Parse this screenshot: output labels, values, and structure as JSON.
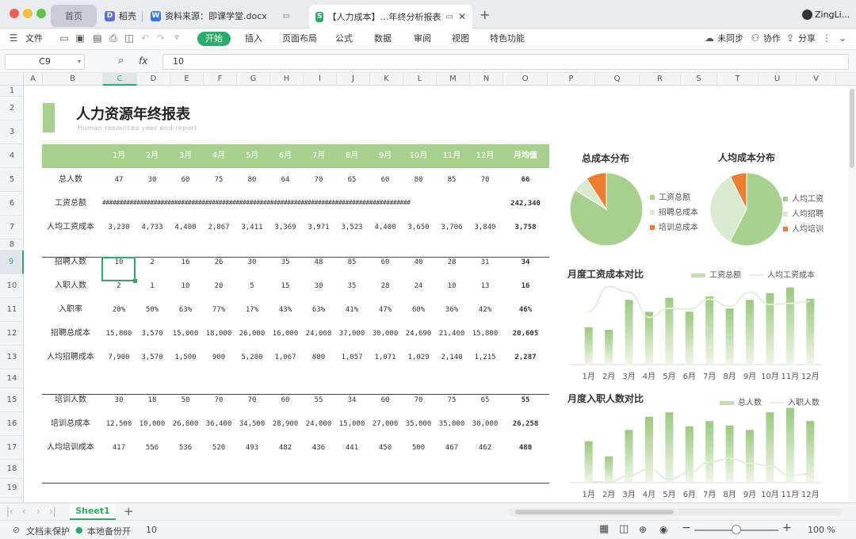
{
  "tabs": [
    {
      "label": "首页"
    },
    {
      "label": "稻壳"
    },
    {
      "label": "资料来源：即课学堂.docx"
    },
    {
      "label": "【人力成本】…年终分析报表"
    }
  ],
  "user": {
    "name": "ZingLi..."
  },
  "menu": {
    "file": "文件",
    "start": "开始",
    "items": [
      "插入",
      "页面布局",
      "公式",
      "数据",
      "审阅",
      "视图",
      "特色功能"
    ],
    "sync": "未同步",
    "collab": "协作",
    "share": "分享"
  },
  "formula": {
    "cell_ref": "C9",
    "fx": "fx",
    "value": "10"
  },
  "columns": [
    "A",
    "B",
    "C",
    "D",
    "E",
    "F",
    "G",
    "H",
    "I",
    "J",
    "K",
    "L",
    "M",
    "N",
    "O",
    "P",
    "Q",
    "R",
    "S",
    "T",
    "U",
    "V"
  ],
  "rows": [
    "1",
    "2",
    "3",
    "4",
    "5",
    "6",
    "7",
    "8",
    "9",
    "10",
    "11",
    "12",
    "13",
    "14",
    "15",
    "16",
    "17",
    "18",
    "19"
  ],
  "report": {
    "title": "人力资源年终报表",
    "subtitle": "Human resources year end report",
    "header": [
      "1月",
      "2月",
      "3月",
      "4月",
      "5月",
      "6月",
      "7月",
      "8月",
      "9月",
      "10月",
      "11月",
      "12月",
      "月均值"
    ],
    "hash_text": "##########################################################################################",
    "table_rows": [
      {
        "label": "总人数",
        "values": [
          "47",
          "30",
          "60",
          "75",
          "80",
          "64",
          "70",
          "65",
          "60",
          "80",
          "85",
          "70"
        ],
        "avg": "66"
      },
      {
        "label": "工资总额",
        "values": [],
        "avg": "242,340"
      },
      {
        "label": "人均工资成本",
        "values": [
          "3,230",
          "4,733",
          "4,400",
          "2,867",
          "3,411",
          "3,369",
          "3,971",
          "3,523",
          "4,400",
          "3,650",
          "3,706",
          "3,840"
        ],
        "avg": "3,758"
      },
      {
        "label": "招聘人数",
        "values": [
          "10",
          "2",
          "16",
          "26",
          "30",
          "35",
          "48",
          "85",
          "60",
          "40",
          "28",
          "31"
        ],
        "avg": "34"
      },
      {
        "label": "入职人数",
        "values": [
          "2",
          "1",
          "10",
          "20",
          "5",
          "15",
          "30",
          "35",
          "28",
          "24",
          "10",
          "13"
        ],
        "avg": "16"
      },
      {
        "label": "入职率",
        "values": [
          "20%",
          "50%",
          "63%",
          "77%",
          "17%",
          "43%",
          "63%",
          "41%",
          "47%",
          "60%",
          "36%",
          "42%"
        ],
        "avg": "46%"
      },
      {
        "label": "招聘总成本",
        "values": [
          "15,800",
          "3,570",
          "15,000",
          "18,000",
          "26,000",
          "16,000",
          "24,000",
          "37,000",
          "30,000",
          "24,690",
          "21,400",
          "15,800"
        ],
        "avg": "20,605"
      },
      {
        "label": "人均招聘成本",
        "values": [
          "7,900",
          "3,570",
          "1,500",
          "900",
          "5,200",
          "1,067",
          "800",
          "1,057",
          "1,071",
          "1,029",
          "2,140",
          "1,215"
        ],
        "avg": "2,287"
      },
      {
        "label": "培训人数",
        "values": [
          "30",
          "18",
          "50",
          "70",
          "70",
          "60",
          "55",
          "34",
          "60",
          "70",
          "75",
          "65"
        ],
        "avg": "55"
      },
      {
        "label": "培训总成本",
        "values": [
          "12,500",
          "10,000",
          "26,800",
          "36,400",
          "34,500",
          "28,900",
          "24,000",
          "15,000",
          "27,000",
          "35,000",
          "35,000",
          "30,000"
        ],
        "avg": "26,258"
      },
      {
        "label": "人均培训成本",
        "values": [
          "417",
          "556",
          "536",
          "520",
          "493",
          "482",
          "436",
          "441",
          "450",
          "500",
          "467",
          "462"
        ],
        "avg": "480"
      }
    ]
  },
  "chart_data": [
    {
      "type": "pie",
      "title": "总成本分布",
      "labels": [
        "工资总额",
        "招聘总成本",
        "培训总成本"
      ],
      "values": [
        2908080,
        247260,
        315100
      ],
      "colors": [
        "#a8d08d",
        "#d9ead0",
        "#ed7d31"
      ],
      "legend": "right"
    },
    {
      "type": "pie",
      "title": "人均成本分布",
      "labels": [
        "人均工资",
        "人均招聘",
        "人均培训"
      ],
      "labels_full": [
        "人均工资成本",
        "人均招聘成本",
        "人均培训成本"
      ],
      "values": [
        3758,
        2287,
        480
      ],
      "colors": [
        "#a8d08d",
        "#d9ead0",
        "#ed7d31"
      ],
      "legend": "right"
    },
    {
      "type": "bar",
      "title": "月度工资成本对比",
      "categories": [
        "1月",
        "2月",
        "3月",
        "4月",
        "5月",
        "6月",
        "7月",
        "8月",
        "9月",
        "10月",
        "11月",
        "12月"
      ],
      "series": [
        {
          "name": "工资总额",
          "values": [
            151810,
            141990,
            264000,
            215025,
            272880,
            215616,
            277970,
            228995,
            264000,
            292000,
            315010,
            268800
          ],
          "kind": "bar"
        },
        {
          "name": "人均工资成本",
          "values": [
            3230,
            4733,
            4400,
            2867,
            3411,
            3369,
            3971,
            3523,
            4400,
            3650,
            3706,
            3840
          ],
          "kind": "line"
        }
      ],
      "legend": "top-right"
    },
    {
      "type": "bar",
      "title": "月度入职人数对比",
      "categories": [
        "1月",
        "2月",
        "3月",
        "4月",
        "5月",
        "6月",
        "7月",
        "8月",
        "9月",
        "10月",
        "11月",
        "12月"
      ],
      "series": [
        {
          "name": "总人数",
          "values": [
            47,
            30,
            60,
            75,
            80,
            64,
            70,
            65,
            60,
            80,
            85,
            70
          ],
          "kind": "bar"
        },
        {
          "name": "入职人数",
          "values": [
            2,
            1,
            10,
            20,
            5,
            15,
            30,
            35,
            28,
            24,
            10,
            13
          ],
          "kind": "line"
        }
      ],
      "legend": "top-right"
    }
  ],
  "sheet_tabs": [
    {
      "label": "Sheet1"
    }
  ],
  "status": {
    "protect": "文档未保护",
    "backup": "本地备份开",
    "cell_value": "10",
    "zoom": "100 %"
  },
  "colors": {
    "accent": "#2aae67",
    "header_green": "#a8d08d",
    "orange": "#ed7d31",
    "light_green": "#d9ead0"
  }
}
